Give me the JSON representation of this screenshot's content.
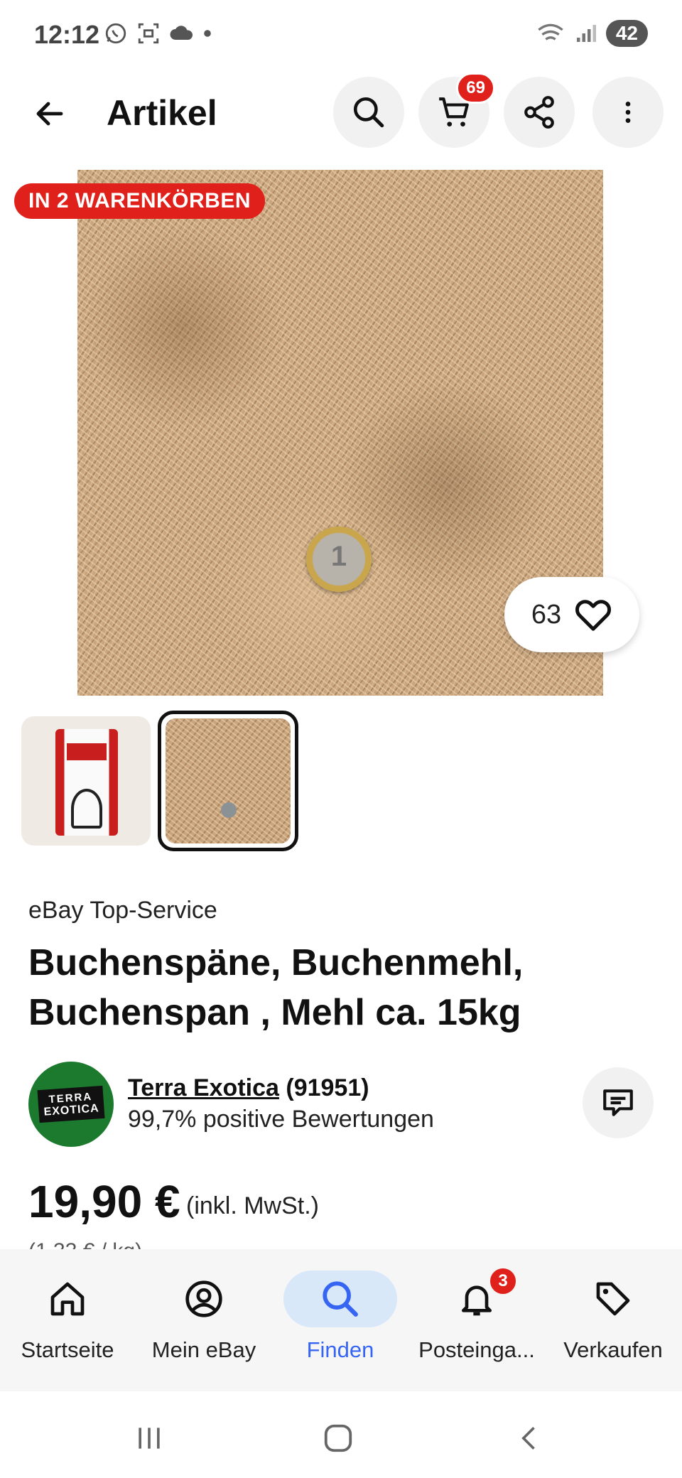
{
  "status_bar": {
    "time": "12:12",
    "battery": "42",
    "icons": [
      "whatsapp-icon",
      "screenshot-icon",
      "cloud-icon",
      "dot-icon",
      "wifi-icon",
      "signal-icon"
    ]
  },
  "app_bar": {
    "title": "Artikel",
    "cart_count": "69"
  },
  "gallery": {
    "tag": "IN 2 WARENKÖRBEN",
    "watch_count": "63",
    "coin_text": "1"
  },
  "product": {
    "top_service": "eBay Top-Service",
    "title": "Buchenspäne, Buchenmehl, Buchenspan , Mehl ca. 15kg",
    "price": "19,90 €",
    "price_note": "(inkl. MwSt.)",
    "unit_price": "(1,33 € / kg)"
  },
  "seller": {
    "logo_line1": "TERRA",
    "logo_line2": "EXOTICA",
    "name": "Terra Exotica",
    "score": "(91951)",
    "rating": "99,7% positive Bewertungen"
  },
  "bottom_nav": {
    "items": [
      {
        "label": "Startseite",
        "icon": "home-icon"
      },
      {
        "label": "Mein eBay",
        "icon": "account-icon"
      },
      {
        "label": "Finden",
        "icon": "search-icon"
      },
      {
        "label": "Posteinga...",
        "icon": "bell-icon",
        "badge": "3"
      },
      {
        "label": "Verkaufen",
        "icon": "tag-icon"
      }
    ]
  },
  "colors": {
    "accent": "#3665f3",
    "badge": "#e0201b",
    "active_bg": "#d8e8f8"
  }
}
